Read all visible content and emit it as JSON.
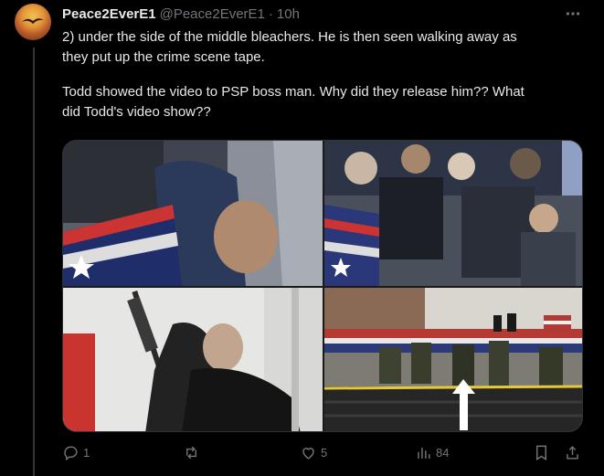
{
  "author": {
    "display_name": "Peace2EverE1",
    "handle": "@Peace2EverE1",
    "separator": "·",
    "time": "10h"
  },
  "more_icon": "more-horizontal-icon",
  "body": {
    "line1": "2) under the side of the middle bleachers. He is then seen walking away as",
    "line2": "they put up the crime scene tape.",
    "line3": "Todd showed the video to PSP boss man. Why did they release him?? What",
    "line4": "did Todd's video show??"
  },
  "media": {
    "count": 4,
    "images": [
      "video-still-top-left",
      "video-still-top-right",
      "video-still-bottom-left",
      "video-still-bottom-right"
    ]
  },
  "actions": {
    "reply": {
      "icon": "reply-icon",
      "count": "1"
    },
    "repost": {
      "icon": "repost-icon",
      "count": ""
    },
    "like": {
      "icon": "heart-icon",
      "count": "5"
    },
    "views": {
      "icon": "views-icon",
      "count": "84"
    },
    "bookmark": {
      "icon": "bookmark-icon"
    },
    "share": {
      "icon": "share-icon"
    }
  },
  "colors": {
    "background": "#000000",
    "text_primary": "#e7e9ea",
    "text_secondary": "#71767b",
    "border": "#2f3336"
  }
}
